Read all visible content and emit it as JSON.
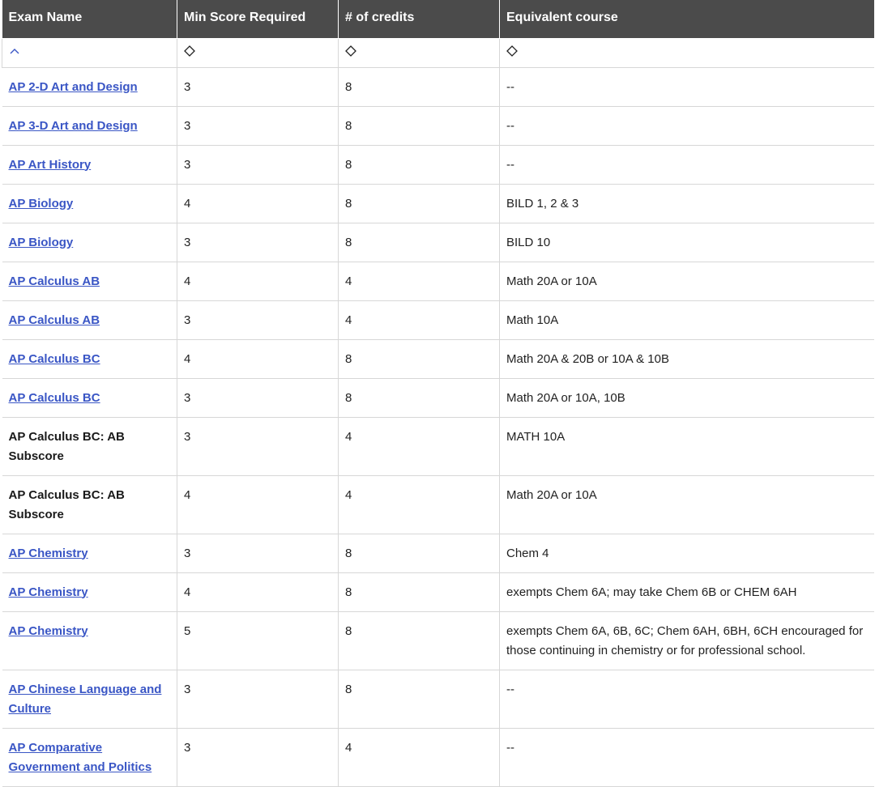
{
  "table": {
    "headers": [
      "Exam Name",
      "Min Score Required",
      "# of credits",
      "Equivalent course"
    ],
    "sort_icons": [
      "chevron-up-icon",
      "sort-diamond-icon",
      "sort-diamond-icon",
      "sort-diamond-icon"
    ],
    "rows": [
      {
        "exam": "AP 2-D Art and Design",
        "link": true,
        "min": "3",
        "credits": "8",
        "course": "--"
      },
      {
        "exam": "AP 3-D Art and Design",
        "link": true,
        "min": "3",
        "credits": "8",
        "course": "--"
      },
      {
        "exam": "AP Art History",
        "link": true,
        "min": "3",
        "credits": "8",
        "course": "--"
      },
      {
        "exam": "AP Biology",
        "link": true,
        "min": "4",
        "credits": "8",
        "course": "BILD 1, 2 & 3"
      },
      {
        "exam": "AP Biology",
        "link": true,
        "min": "3",
        "credits": "8",
        "course": "BILD 10"
      },
      {
        "exam": "AP Calculus AB",
        "link": true,
        "min": "4",
        "credits": "4",
        "course": "Math 20A or 10A"
      },
      {
        "exam": "AP Calculus AB",
        "link": true,
        "min": "3",
        "credits": "4",
        "course": "Math 10A"
      },
      {
        "exam": "AP Calculus BC",
        "link": true,
        "min": "4",
        "credits": "8",
        "course": "Math 20A & 20B or 10A & 10B"
      },
      {
        "exam": "AP Calculus BC",
        "link": true,
        "min": "3",
        "credits": "8",
        "course": "Math 20A or 10A, 10B"
      },
      {
        "exam": "AP Calculus BC: AB Subscore",
        "link": false,
        "min": "3",
        "credits": "4",
        "course": "MATH 10A"
      },
      {
        "exam": "AP Calculus BC: AB Subscore",
        "link": false,
        "min": "4",
        "credits": "4",
        "course": "Math 20A or 10A"
      },
      {
        "exam": "AP Chemistry",
        "link": true,
        "min": "3",
        "credits": "8",
        "course": "Chem 4"
      },
      {
        "exam": "AP Chemistry",
        "link": true,
        "min": "4",
        "credits": "8",
        "course": "exempts Chem 6A; may take Chem 6B or CHEM 6AH"
      },
      {
        "exam": "AP Chemistry",
        "link": true,
        "min": "5",
        "credits": "8",
        "course": "exempts Chem 6A, 6B, 6C; Chem 6AH, 6BH, 6CH encouraged for those continuing in chemistry or for professional school."
      },
      {
        "exam": "AP Chinese Language and Culture",
        "link": true,
        "min": "3",
        "credits": "8",
        "course": "--"
      },
      {
        "exam": "AP Comparative Government and Politics",
        "link": true,
        "min": "3",
        "credits": "4",
        "course": "--"
      }
    ]
  }
}
